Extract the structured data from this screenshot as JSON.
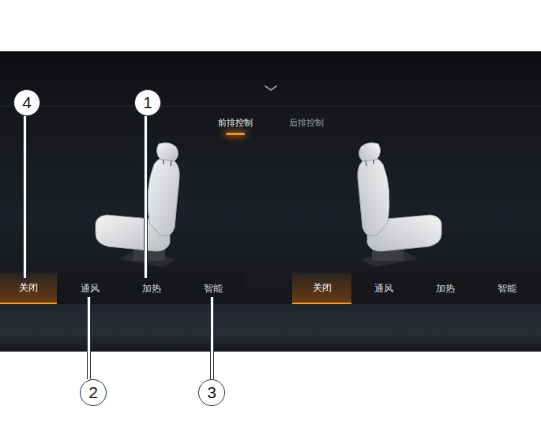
{
  "tabs": [
    {
      "label": "前排控制",
      "selected": true
    },
    {
      "label": "后排控制",
      "selected": false
    }
  ],
  "seats": [
    {
      "modes": [
        {
          "label": "关闭",
          "selected": true
        },
        {
          "label": "通风",
          "selected": false
        },
        {
          "label": "加热",
          "selected": false
        },
        {
          "label": "智能",
          "selected": false
        }
      ]
    },
    {
      "modes": [
        {
          "label": "关闭",
          "selected": true
        },
        {
          "label": "通风",
          "selected": false
        },
        {
          "label": "加热",
          "selected": false
        },
        {
          "label": "智能",
          "selected": false
        }
      ]
    }
  ],
  "callouts": [
    {
      "number": "4"
    },
    {
      "number": "1"
    },
    {
      "number": "2"
    },
    {
      "number": "3"
    }
  ]
}
